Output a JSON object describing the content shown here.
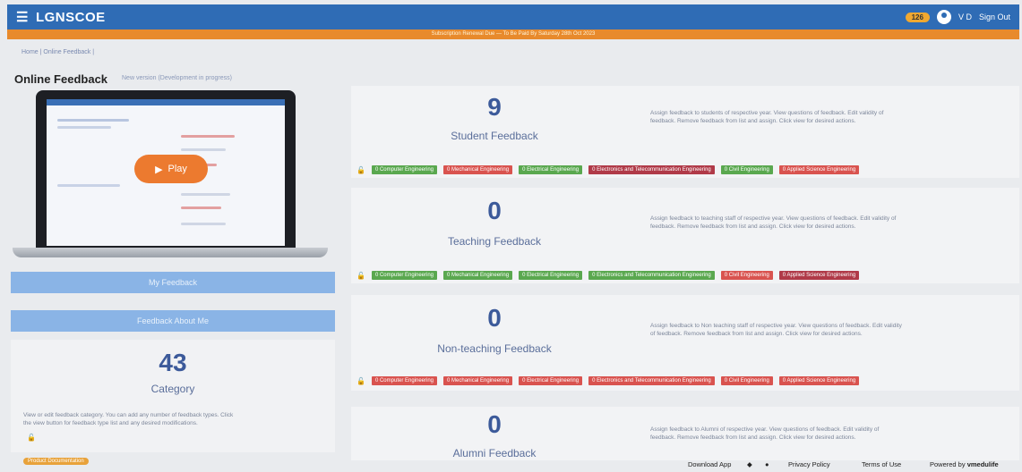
{
  "header": {
    "brand": "LGNSCOE",
    "notification_count": "126",
    "user_initials": "V D",
    "sign_out": "Sign Out",
    "notice": "Subscription Renewal Due — To Be Paid By Saturday 28th Oct 2023"
  },
  "breadcrumb": "Home | Online Feedback |",
  "page": {
    "title": "Online Feedback",
    "subtitle": "New version (Development in progress)"
  },
  "video": {
    "play_label": "Play"
  },
  "sidebar": {
    "my_feedback": "My Feedback",
    "feedback_about_me": "Feedback About Me"
  },
  "category": {
    "count": "43",
    "label": "Category",
    "desc_line1": "View or edit feedback category. You can add any number of feedback types. Click",
    "desc_line2": "the view button for feedback type list and any desired modifications."
  },
  "product_badge": "Product Documentation",
  "feedback_cards": [
    {
      "count": "9",
      "title": "Student Feedback",
      "desc_line1": "Assign feedback to students of respective year. View questions of feedback. Edit validity of",
      "desc_line2": "feedback. Remove feedback from list and assign. Click view for desired actions.",
      "tags": [
        {
          "label": "0 Computer Engineering",
          "color": "green"
        },
        {
          "label": "0 Mechanical Engineering",
          "color": "red"
        },
        {
          "label": "0 Electrical Engineering",
          "color": "green"
        },
        {
          "label": "0 Electronics and Telecommunication Engineering",
          "color": "maroon"
        },
        {
          "label": "0 Civil Engineering",
          "color": "green"
        },
        {
          "label": "0 Applied Science Engineering",
          "color": "red"
        }
      ]
    },
    {
      "count": "0",
      "title": "Teaching Feedback",
      "desc_line1": "Assign feedback to teaching staff of respective year. View questions of feedback. Edit validity of",
      "desc_line2": "feedback. Remove feedback from list and assign. Click view for desired actions.",
      "tags": [
        {
          "label": "0 Computer Engineering",
          "color": "green"
        },
        {
          "label": "0 Mechanical Engineering",
          "color": "green"
        },
        {
          "label": "0 Electrical Engineering",
          "color": "green"
        },
        {
          "label": "0 Electronics and Telecommunication Engineering",
          "color": "green"
        },
        {
          "label": "0 Civil Engineering",
          "color": "red"
        },
        {
          "label": "0 Applied Science Engineering",
          "color": "maroon"
        }
      ]
    },
    {
      "count": "0",
      "title": "Non-teaching Feedback",
      "desc_line1": "Assign feedback to Non teaching staff of respective year. View questions of feedback. Edit validity",
      "desc_line2": "of feedback. Remove feedback from list and assign. Click view for desired actions.",
      "tags": [
        {
          "label": "0 Computer Engineering",
          "color": "red"
        },
        {
          "label": "0 Mechanical Engineering",
          "color": "red"
        },
        {
          "label": "0 Electrical Engineering",
          "color": "red"
        },
        {
          "label": "0 Electronics and Telecommunication Engineering",
          "color": "red"
        },
        {
          "label": "0 Civil Engineering",
          "color": "red"
        },
        {
          "label": "0 Applied Science Engineering",
          "color": "red"
        }
      ]
    },
    {
      "count": "0",
      "title": "Alumni Feedback",
      "desc_line1": "Assign feedback to Alumni of respective year. View questions of feedback. Edit validity of",
      "desc_line2": "feedback. Remove feedback from list and assign. Click view for desired actions.",
      "tags": []
    }
  ],
  "footer": {
    "download_app": "Download App",
    "privacy": "Privacy Policy",
    "terms": "Terms of Use",
    "powered_by": "Powered by",
    "powered_brand": "vmedulife"
  },
  "colors": {
    "header": "#2f6cb5",
    "notice": "#e88a2c",
    "accent_number": "#3c5a9a",
    "tag_green": "#5aa84f",
    "tag_red": "#d9534f",
    "tag_maroon": "#b03a48"
  }
}
